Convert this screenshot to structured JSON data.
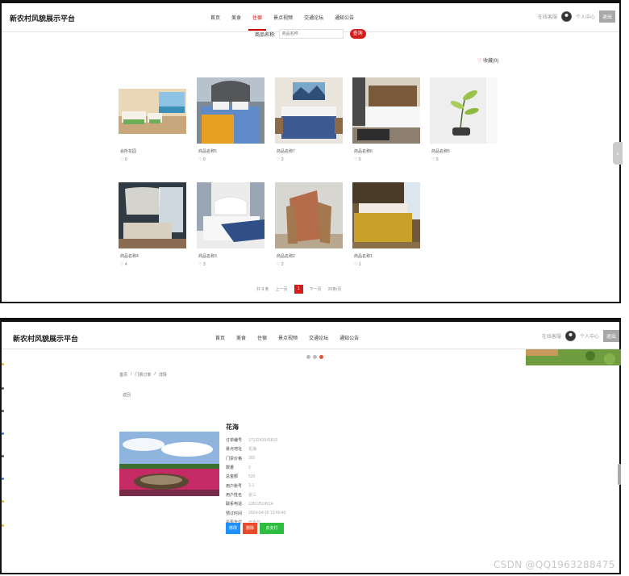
{
  "top_panel": {
    "brand": "新农村风貌展示平台",
    "nav": [
      "首页",
      "美食",
      "住宿",
      "景点视频",
      "交通论坛",
      "通知公告"
    ],
    "active_nav": "住宿",
    "user": {
      "online": "在线客服",
      "center": "个人中心",
      "logout": "退出"
    },
    "search": {
      "label": "商品名称:",
      "placeholder": "商品名称",
      "button": "查询"
    },
    "favorites_label": "收藏(0)",
    "cards": [
      {
        "title": "会所花园",
        "likes": "0"
      },
      {
        "title": "商品名称5",
        "likes": "0"
      },
      {
        "title": "商品名称7",
        "likes": "2"
      },
      {
        "title": "商品名称6",
        "likes": "5"
      },
      {
        "title": "商品名称5",
        "likes": "5"
      },
      {
        "title": "商品名称4",
        "likes": "4"
      },
      {
        "title": "商品名称3",
        "likes": "3"
      },
      {
        "title": "商品名称2",
        "likes": "2"
      },
      {
        "title": "商品名称1",
        "likes": "1"
      }
    ],
    "pagination": {
      "total": "共 9 条",
      "prev": "上一页",
      "current": "1",
      "next": "下一页",
      "page_size": "20条/页"
    }
  },
  "bottom_panel": {
    "brand": "新农村风貌展示平台",
    "nav": [
      "首页",
      "美食",
      "住宿",
      "景点视频",
      "交通论坛",
      "通知公告"
    ],
    "user": {
      "online": "在线客服",
      "center": "个人中心",
      "logout": "退出"
    },
    "breadcrumb": [
      "首页",
      "门票订单",
      "详情"
    ],
    "back_label": "返回",
    "detail": {
      "title": "花海",
      "rows": [
        {
          "key": "订单编号",
          "value": "1713243541810"
        },
        {
          "key": "景点地址",
          "value": "花海"
        },
        {
          "key": "门票价格",
          "value": "260"
        },
        {
          "key": "数量",
          "value": "2"
        },
        {
          "key": "总金额",
          "value": "520"
        },
        {
          "key": "用户账号",
          "value": "1-1"
        },
        {
          "key": "用户姓名",
          "value": "张三"
        },
        {
          "key": "联系电话",
          "value": "13512514514"
        },
        {
          "key": "预订时间",
          "value": "2024-04-16 13:40:40"
        },
        {
          "key": "是否支付",
          "value": "已支付"
        }
      ],
      "actions": {
        "edit": "修改",
        "delete": "删除",
        "pay": "去支付"
      }
    }
  },
  "watermark": "CSDN @QQ1963288475",
  "colors": {
    "accent": "#d61b1b",
    "edit": "#1e90ff",
    "delete": "#e84a2b",
    "pay": "#2ebd3e"
  }
}
